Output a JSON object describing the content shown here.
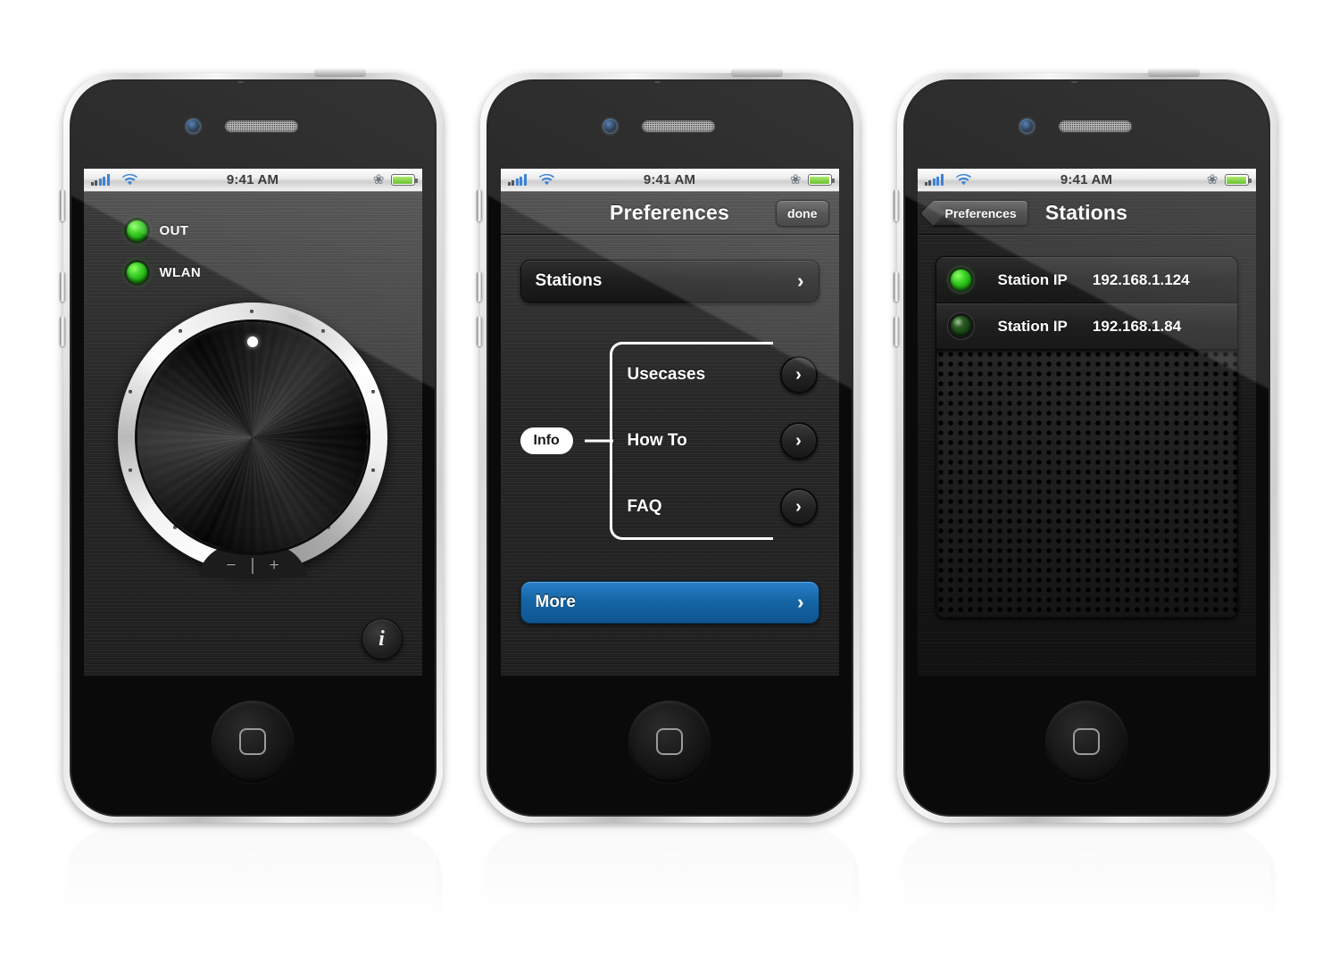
{
  "statusbar": {
    "time": "9:41 AM",
    "signal_icon": "cellular-signal-icon",
    "wifi_icon": "wifi-icon",
    "bluetooth_icon": "bluetooth-icon",
    "battery_icon": "battery-icon"
  },
  "phone1": {
    "leds": [
      {
        "label": "OUT",
        "state": "on",
        "color": "#3fd22a"
      },
      {
        "label": "WLAN",
        "state": "on",
        "color": "#3fd22a"
      }
    ],
    "dial": {
      "name": "volume-dial",
      "minus_mark": "−",
      "center_mark": "|",
      "plus_mark": "+"
    },
    "info_button": {
      "glyph": "i",
      "name": "info-button"
    }
  },
  "phone2": {
    "nav": {
      "title": "Preferences",
      "done_label": "done"
    },
    "stations_button": {
      "label": "Stations",
      "chevron": "›"
    },
    "info_group": {
      "pill_label": "Info",
      "rows": [
        {
          "label": "Usecases",
          "chevron": "›"
        },
        {
          "label": "How To",
          "chevron": "›"
        },
        {
          "label": "FAQ",
          "chevron": "›"
        }
      ]
    },
    "more_button": {
      "label": "More",
      "chevron": "›",
      "color": "#1464a4"
    }
  },
  "phone3": {
    "nav": {
      "back_label": "Preferences",
      "title": "Stations"
    },
    "rows": [
      {
        "led": "on",
        "name": "Station IP",
        "ip": "192.168.1.124"
      },
      {
        "led": "off",
        "name": "Station IP",
        "ip": "192.168.1.84"
      }
    ]
  }
}
